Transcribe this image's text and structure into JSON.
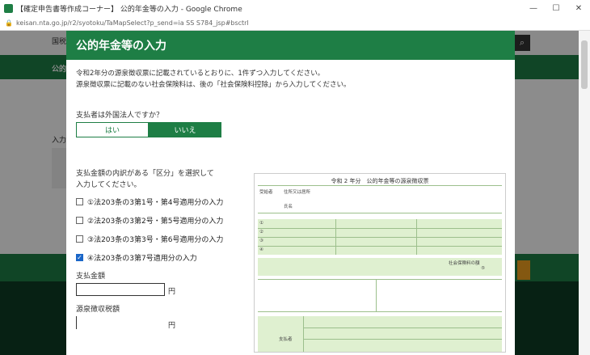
{
  "window": {
    "title": "【確定申告書等作成コーナー】 公的年金等の入力 - Google Chrome",
    "minimize": "—",
    "maximize": "☐",
    "close": "✕",
    "url": "keisan.nta.go.jp/r2/syotoku/TaMapSelect?p_send=ia SS S784_jsp#bsctrl"
  },
  "background": {
    "bg_text_1": "国税庁",
    "bg_text_2": "公的",
    "bg_text_3": "入力",
    "search_icon": "search-icon"
  },
  "modal": {
    "title": "公的年金等の入力",
    "intro_line1": "令和2年分の源泉徴収票に記載されているとおりに、1件ずつ入力してください。",
    "intro_line2": "源泉徴収票に記載のない社会保険料は、後の「社会保険料控除」から入力してください。",
    "question": "支払者は外国法人ですか？",
    "toggle_yes": "はい",
    "toggle_no": "いいえ",
    "category_label_line1": "支払金額の内訳がある「区分」を選択して",
    "category_label_line2": "入力してください。",
    "options": [
      {
        "label": "①法203条の3第1号・第4号適用分の入力",
        "checked": false
      },
      {
        "label": "②法203条の3第2号・第5号適用分の入力",
        "checked": false
      },
      {
        "label": "③法203条の3第3号・第6号適用分の入力",
        "checked": false
      },
      {
        "label": "④法203条の3第7号適用分の入力",
        "checked": true
      }
    ],
    "amount_label": "支払金額",
    "amount_unit": "円",
    "withholding_label": "源泉徴収税額",
    "withholding_unit": "円"
  },
  "form_image": {
    "title": "令和 2 年分　公的年金等の源泉徴収票",
    "row_labels": [
      "①",
      "②",
      "③",
      "④"
    ],
    "label_recipient": "受給者",
    "label_payer": "支払者",
    "label_address": "住所又は居所",
    "label_name": "氏名",
    "label_tax": "社会保険料の額",
    "label_number": "⑤"
  },
  "colors": {
    "brand_green": "#1e7e45",
    "checkbox_blue": "#1a66c8"
  }
}
